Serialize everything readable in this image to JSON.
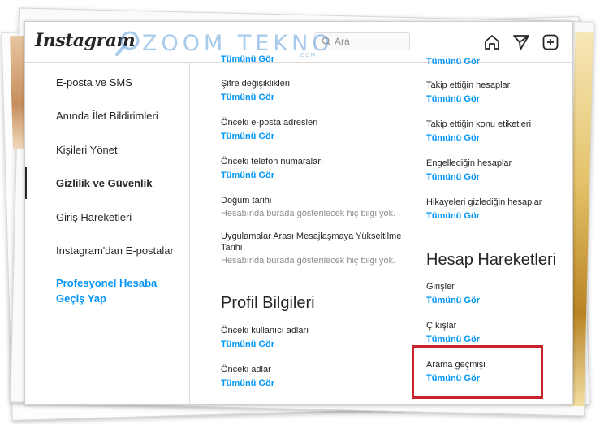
{
  "header": {
    "logo": "Instagram",
    "search_placeholder": "Ara",
    "watermark": "ZOOM TEKNO",
    "watermark_sub": ".COM"
  },
  "icons": {
    "home": "home-icon",
    "direct": "paper-plane-icon",
    "new_post": "plus-square-icon",
    "search": "search-icon"
  },
  "sidebar": {
    "items": [
      {
        "label": "E-posta ve SMS"
      },
      {
        "label": "Anında İlet Bildirimleri"
      },
      {
        "label": "Kişileri Yönet"
      },
      {
        "label": "Gizlilik ve Güvenlik"
      },
      {
        "label": "Giriş Hareketleri"
      },
      {
        "label": "Instagram'dan E-postalar"
      },
      {
        "label": "Profesyonel Hesaba Geçiş Yap"
      }
    ]
  },
  "middle": {
    "top_link": "Tümünü Gör",
    "items": [
      {
        "label": "Şifre değişiklikleri",
        "link": "Tümünü Gör"
      },
      {
        "label": "Önceki e-posta adresleri",
        "link": "Tümünü Gör"
      },
      {
        "label": "Önceki telefon numaraları",
        "link": "Tümünü Gör"
      },
      {
        "label": "Doğum tarihi",
        "note": "Hesabında burada gösterilecek hiç bilgi yok."
      },
      {
        "label": "Uygulamalar Arası Mesajlaşmaya Yükseltilme Tarihi",
        "note": "Hesabında burada gösterilecek hiç bilgi yok."
      }
    ],
    "section_title": "Profil Bilgileri",
    "profile_items": [
      {
        "label": "Önceki kullanıcı adları",
        "link": "Tümünü Gör"
      },
      {
        "label": "Önceki adlar",
        "link": "Tümünü Gör"
      }
    ]
  },
  "right": {
    "top_link": "Tümünü Gör",
    "items": [
      {
        "label": "Takip ettiğin hesaplar",
        "link": "Tümünü Gör"
      },
      {
        "label": "Takip ettiğin konu etiketleri",
        "link": "Tümünü Gör"
      },
      {
        "label": "Engellediğin hesaplar",
        "link": "Tümünü Gör"
      },
      {
        "label": "Hikayeleri gizlediğin hesaplar",
        "link": "Tümünü Gör"
      }
    ],
    "section_title": "Hesap Hareketleri",
    "activity_items": [
      {
        "label": "Girişler",
        "link": "Tümünü Gör"
      },
      {
        "label": "Çıkışlar",
        "link": "Tümünü Gör"
      },
      {
        "label": "Arama geçmişi",
        "link": "Tümünü Gör"
      }
    ]
  },
  "colors": {
    "link": "#0095f6",
    "highlight": "#c8242e"
  }
}
